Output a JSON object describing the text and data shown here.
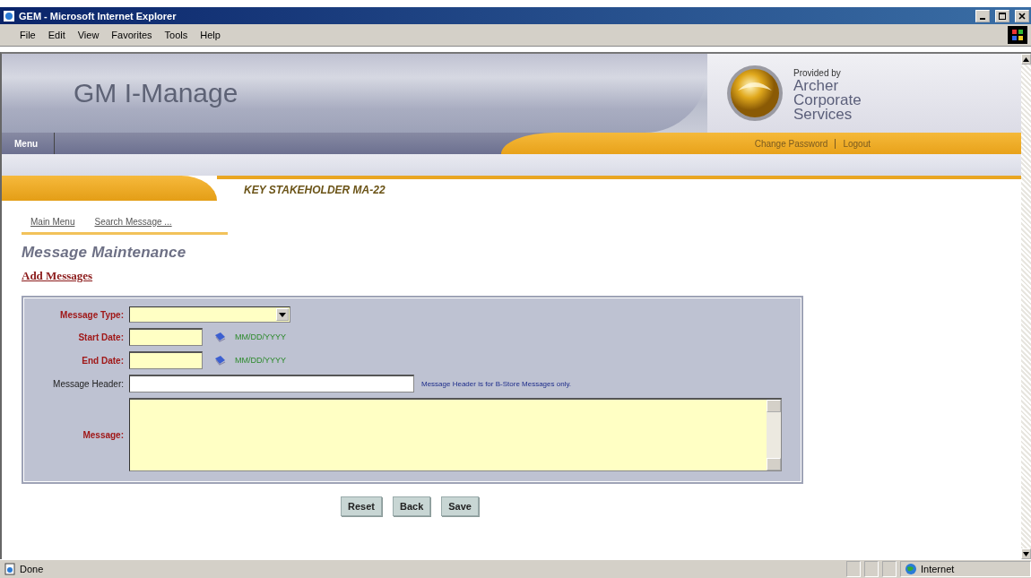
{
  "window": {
    "title": "GEM - Microsoft Internet Explorer"
  },
  "menu_items": [
    "File",
    "Edit",
    "View",
    "Favorites",
    "Tools",
    "Help"
  ],
  "header": {
    "app_title": "GM I-Manage",
    "provider_caption": "Provided by",
    "provider_lines": [
      "Archer",
      "Corporate",
      "Services"
    ]
  },
  "nav": {
    "left": "Menu",
    "right": [
      "Change Password",
      "Logout"
    ]
  },
  "banner": "KEY STAKEHOLDER MA-22",
  "breadcrumbs": [
    "Main Menu",
    "Search Message ..."
  ],
  "page_title": "Message Maintenance",
  "section_link": "Add Messages",
  "fields": [
    {
      "label": "Message Type:",
      "kind": "select",
      "required": true
    },
    {
      "label": "Start Date:",
      "kind": "date",
      "required": true,
      "hint": "MM/DD/YYYY"
    },
    {
      "label": "End Date:",
      "kind": "date",
      "required": true,
      "hint": "MM/DD/YYYY"
    },
    {
      "label": "Message Header:",
      "kind": "text",
      "required": false,
      "hint": "Message Header is for B-Store Messages only."
    },
    {
      "label": "Message:",
      "kind": "textarea",
      "required": true
    }
  ],
  "buttons": [
    "Reset",
    "Back",
    "Save"
  ],
  "status_bar": {
    "text": "Done",
    "zone": "Internet"
  }
}
